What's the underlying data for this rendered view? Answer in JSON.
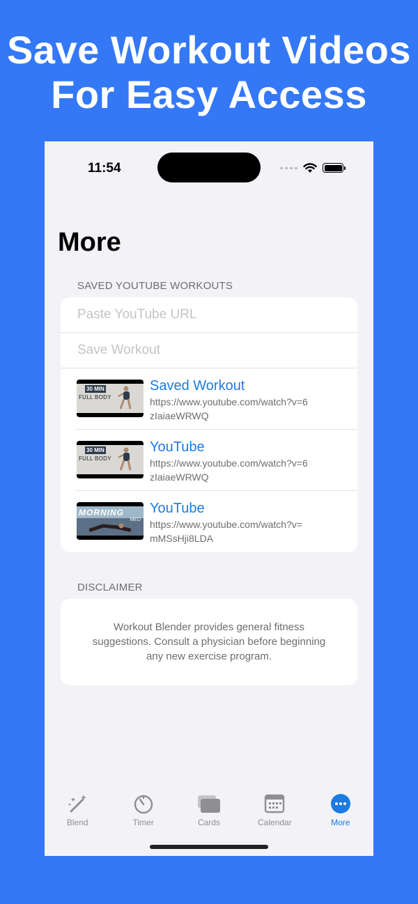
{
  "headline": [
    "Save Workout Videos",
    "For Easy Access"
  ],
  "status_bar": {
    "time": "11:54"
  },
  "page_title": "More",
  "saved_section": {
    "header": "SAVED YOUTUBE WORKOUTS",
    "url_placeholder": "Paste YouTube URL",
    "save_label": "Save Workout",
    "videos": [
      {
        "title": "Saved Workout",
        "url": "https://www.youtube.com/watch?v=6zIaiaeWRWQ",
        "thumb_tag": "30 MIN",
        "thumb_text": "FULL BODY"
      },
      {
        "title": "YouTube",
        "url": "https://www.youtube.com/watch?v=6zIaiaeWRWQ",
        "thumb_tag": "30 MIN",
        "thumb_text": "FULL BODY"
      },
      {
        "title": "YouTube",
        "url": "https://www.youtube.com/watch?v=mMSsHji8LDA",
        "thumb_tag": "MORNING",
        "thumb_text": "MED"
      }
    ]
  },
  "disclaimer": {
    "header": "DISCLAIMER",
    "text": "Workout Blender provides general fitness suggestions. Consult a physician before beginning any new exercise program."
  },
  "tabs": [
    {
      "label": "Blend",
      "icon": "magic-wand-icon",
      "active": false
    },
    {
      "label": "Timer",
      "icon": "timer-icon",
      "active": false
    },
    {
      "label": "Cards",
      "icon": "cards-icon",
      "active": false
    },
    {
      "label": "Calendar",
      "icon": "calendar-icon",
      "active": false
    },
    {
      "label": "More",
      "icon": "more-icon",
      "active": true
    }
  ],
  "colors": {
    "background": "#3478F6",
    "accent": "#1C7BE0",
    "screen": "#F2F2F7"
  }
}
